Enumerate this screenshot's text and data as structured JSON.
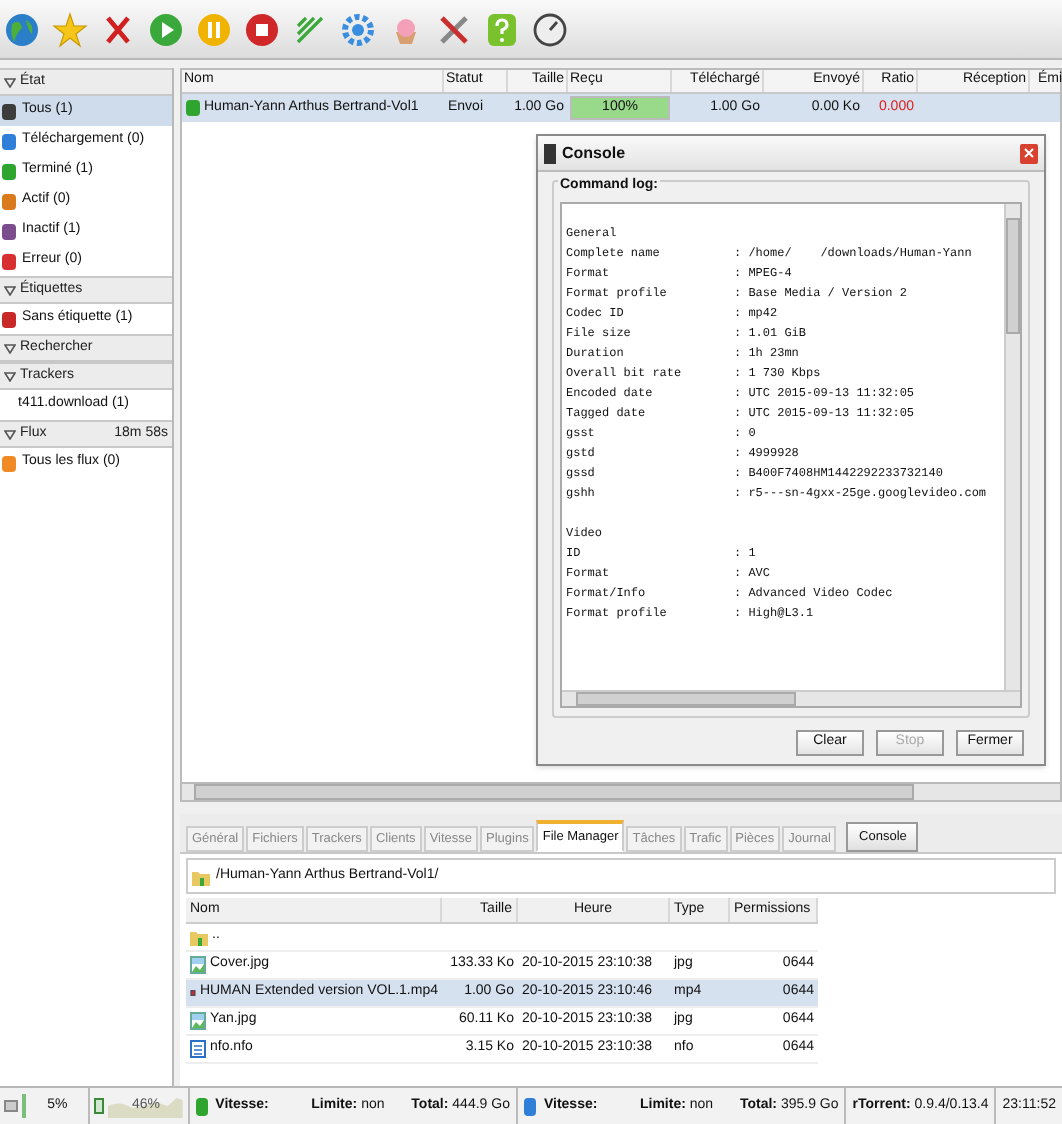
{
  "sidebar": {
    "sections": [
      {
        "title": "État",
        "items": [
          {
            "label": "Tous (1)",
            "selected": true,
            "color": "#3c3c3c"
          },
          {
            "label": "Téléchargement (0)",
            "selected": false,
            "color": "#2f7fd8"
          },
          {
            "label": "Terminé (1)",
            "selected": false,
            "color": "#2fa52f"
          },
          {
            "label": "Actif (0)",
            "selected": false,
            "color": "#d97b1c"
          },
          {
            "label": "Inactif (1)",
            "selected": false,
            "color": "#7a4d8c"
          },
          {
            "label": "Erreur (0)",
            "selected": false,
            "color": "#d83030"
          }
        ]
      },
      {
        "title": "Étiquettes",
        "items": [
          {
            "label": "Sans étiquette (1)",
            "selected": false,
            "color": "#c82828"
          }
        ]
      },
      {
        "title": "Rechercher"
      },
      {
        "title": "Trackers",
        "items": [
          {
            "label": "t411.download (1)",
            "selected": false
          }
        ]
      },
      {
        "title": "Flux",
        "extra": "18m 58s",
        "items": [
          {
            "label": "Tous les flux (0)",
            "selected": false,
            "color": "#f08a24"
          }
        ]
      }
    ]
  },
  "torrents": {
    "columns": [
      "Nom",
      "Statut",
      "Taille",
      "Reçu",
      "Téléchargé",
      "Envoyé",
      "Ratio",
      "Réception",
      "Émi"
    ],
    "rows": [
      {
        "name": "Human-Yann Arthus Bertrand-Vol1",
        "status": "Envoi",
        "size": "1.00 Go",
        "received": "100%",
        "level": 1,
        "downloaded": "1.00 Go",
        "uploaded": "0.00 Ko",
        "ratio": "0.000",
        "selected": true
      }
    ]
  },
  "console": {
    "title": "Console",
    "group": "Command log:",
    "lines": [
      {
        "kind": "heading",
        "label": "General"
      },
      {
        "label": "Complete name",
        "value": ": /home/    /downloads/Human-Yann"
      },
      {
        "label": "Format",
        "value": ": MPEG-4"
      },
      {
        "label": "Format profile",
        "value": ": Base Media / Version 2"
      },
      {
        "label": "Codec ID",
        "value": ": mp42"
      },
      {
        "label": "File size",
        "value": ": 1.01 GiB"
      },
      {
        "label": "Duration",
        "value": ": 1h 23mn"
      },
      {
        "label": "Overall bit rate",
        "value": ": 1 730 Kbps"
      },
      {
        "label": "Encoded date",
        "value": ": UTC 2015-09-13 11:32:05"
      },
      {
        "label": "Tagged date",
        "value": ": UTC 2015-09-13 11:32:05"
      },
      {
        "label": "gsst",
        "value": ": 0"
      },
      {
        "label": "gstd",
        "value": ": 4999928"
      },
      {
        "label": "gssd",
        "value": ": B400F7408HM1442292233732140"
      },
      {
        "label": "gshh",
        "value": ": r5---sn-4gxx-25ge.googlevideo.com"
      },
      {
        "kind": "blank"
      },
      {
        "kind": "heading",
        "label": "Video"
      },
      {
        "label": "ID",
        "value": ": 1"
      },
      {
        "label": "Format",
        "value": ": AVC"
      },
      {
        "label": "Format/Info",
        "value": ": Advanced Video Codec"
      },
      {
        "label": "Format profile",
        "value": ": High@L3.1"
      }
    ],
    "buttons": [
      {
        "label": "Clear",
        "disabled": false
      },
      {
        "label": "Stop",
        "disabled": true
      },
      {
        "label": "Fermer",
        "disabled": false
      }
    ]
  },
  "tabs": [
    {
      "label": "Général",
      "selected": false,
      "kind": "tab"
    },
    {
      "label": "Fichiers",
      "selected": false,
      "kind": "tab"
    },
    {
      "label": "Trackers",
      "selected": false,
      "kind": "tab"
    },
    {
      "label": "Clients",
      "selected": false,
      "kind": "tab"
    },
    {
      "label": "Vitesse",
      "selected": false,
      "kind": "tab"
    },
    {
      "label": "Plugins",
      "selected": false,
      "kind": "tab"
    },
    {
      "label": "File Manager",
      "selected": true,
      "kind": "tab"
    },
    {
      "label": "Tâches",
      "selected": false,
      "kind": "tab"
    },
    {
      "label": "Trafic",
      "selected": false,
      "kind": "tab"
    },
    {
      "label": "Pièces",
      "selected": false,
      "kind": "tab"
    },
    {
      "label": "Journal",
      "selected": false,
      "kind": "tab"
    },
    {
      "label": "Console",
      "selected": false,
      "kind": "button"
    }
  ],
  "file_manager": {
    "path": "/Human-Yann Arthus Bertrand-Vol1/",
    "columns": [
      "Nom",
      "Taille",
      "Heure",
      "Type",
      "Permissions"
    ],
    "rows": [
      {
        "kind": "parent",
        "name": "..",
        "selected": false
      },
      {
        "kind": "image",
        "name": "Cover.jpg",
        "size": "133.33 Ko",
        "time": "20-10-2015 23:10:38",
        "type": "jpg",
        "permissions": "0644",
        "selected": false
      },
      {
        "kind": "video",
        "name": "HUMAN Extended version VOL.1.mp4",
        "size": "1.00 Go",
        "time": "20-10-2015 23:10:46",
        "type": "mp4",
        "permissions": "0644",
        "selected": true
      },
      {
        "kind": "image",
        "name": "Yan.jpg",
        "size": "60.11 Ko",
        "time": "20-10-2015 23:10:38",
        "type": "jpg",
        "permissions": "0644",
        "selected": false
      },
      {
        "kind": "text",
        "name": "nfo.nfo",
        "size": "3.15 Ko",
        "time": "20-10-2015 23:10:38",
        "type": "nfo",
        "permissions": "0644",
        "selected": false
      }
    ]
  },
  "status_bar": {
    "disk": "5%",
    "cpu": "46%",
    "download": {
      "speed_label": "Vitesse:",
      "limit_label": "Limite:",
      "limit": "non",
      "total_label": "Total:",
      "total": "444.9 Go"
    },
    "upload": {
      "speed_label": "Vitesse:",
      "limit_label": "Limite:",
      "limit": "non",
      "total_label": "Total:",
      "total": "395.9 Go"
    },
    "client_label": "rTorrent:",
    "client": "0.9.4/0.13.4",
    "time": "23:11:52"
  }
}
